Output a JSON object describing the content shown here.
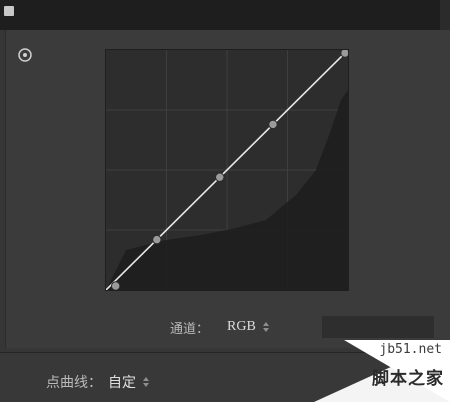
{
  "channel": {
    "label": "通道：",
    "value": "RGB",
    "icon": "up-down-arrows-icon"
  },
  "point_curve": {
    "label": "点曲线：",
    "value": "自定",
    "icon": "up-down-arrows-icon"
  },
  "watermark": {
    "site": "jb51.net",
    "name": "脚本之家"
  },
  "target_tool": {
    "icon": "target-adjustment-icon"
  },
  "curve": {
    "points": [
      [
        0.04,
        0.0
      ],
      [
        0.21,
        0.21
      ],
      [
        0.47,
        0.47
      ],
      [
        0.69,
        0.69
      ],
      [
        1.0,
        1.0
      ]
    ],
    "line_color": "#e8e8e8",
    "histogram_color": "#1c1c1c"
  }
}
